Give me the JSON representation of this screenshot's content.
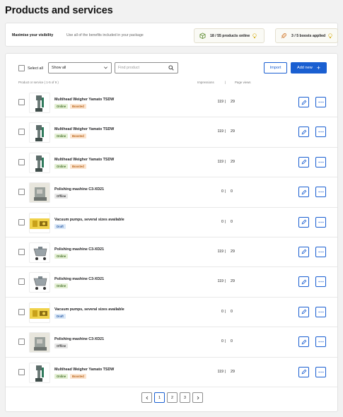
{
  "page": {
    "title": "Products and services"
  },
  "visibility": {
    "title": "Maximise your visibility",
    "description": "Use all of the benefits included in your package",
    "products_online": "18 / 55 products online",
    "boosts_applied": "3 / 5 boosts applied"
  },
  "toolbar": {
    "select_all_label": "Select all",
    "filter_value": "Show all",
    "search_placeholder": "Find product",
    "import_label": "Import",
    "add_new_label": "Add new"
  },
  "table": {
    "header_product": "Product or service ( 1-5 of 9 )",
    "header_impressions": "Impressions",
    "header_separator": "|",
    "header_page_views": "Page views",
    "stat_separator": "|",
    "rows": [
      {
        "name": "Multihead Weigher Yamato TSDW",
        "badges": [
          "Online",
          "Boosted"
        ],
        "impressions": "119",
        "page_views": "29",
        "thumb": "weigher"
      },
      {
        "name": "Multihead Weigher Yamato TSDW",
        "badges": [
          "Online",
          "Boosted"
        ],
        "impressions": "119",
        "page_views": "29",
        "thumb": "weigher"
      },
      {
        "name": "Multihead Weigher Yamato TSDW",
        "badges": [
          "Online",
          "Boosted"
        ],
        "impressions": "119",
        "page_views": "29",
        "thumb": "weigher"
      },
      {
        "name": "Polishing mashine C3-XD21",
        "badges": [
          "Offline"
        ],
        "impressions": "0",
        "page_views": "0",
        "thumb": "polisher"
      },
      {
        "name": "Vacuum pumps, several sizes available",
        "badges": [
          "Draft"
        ],
        "impressions": "0",
        "page_views": "0",
        "thumb": "pump"
      },
      {
        "name": "Polishing mashine C3-XD21",
        "badges": [
          "Online"
        ],
        "impressions": "119",
        "page_views": "29",
        "thumb": "cart"
      },
      {
        "name": "Polishing mashine C3-XD21",
        "badges": [
          "Online"
        ],
        "impressions": "119",
        "page_views": "29",
        "thumb": "cart"
      },
      {
        "name": "Vacuum pumps, several sizes available",
        "badges": [
          "Draft"
        ],
        "impressions": "0",
        "page_views": "0",
        "thumb": "pump"
      },
      {
        "name": "Polishing mashine C3-XD21",
        "badges": [
          "Offline"
        ],
        "impressions": "0",
        "page_views": "0",
        "thumb": "polisher"
      },
      {
        "name": "Multihead Weigher Yamato TSDW",
        "badges": [
          "Online",
          "Boosted"
        ],
        "impressions": "119",
        "page_views": "29",
        "thumb": "weigher"
      }
    ]
  },
  "pagination": {
    "prev_icon": "chevron-left-icon",
    "pages": [
      "1",
      "2",
      "3"
    ],
    "current": "1",
    "next_icon": "chevron-right-icon"
  },
  "colors": {
    "accent": "#1a5fd1",
    "online": "#e3efd3",
    "boosted": "#fbe4cf",
    "draft": "#dbe8f7",
    "offline": "#e6e6e6"
  }
}
